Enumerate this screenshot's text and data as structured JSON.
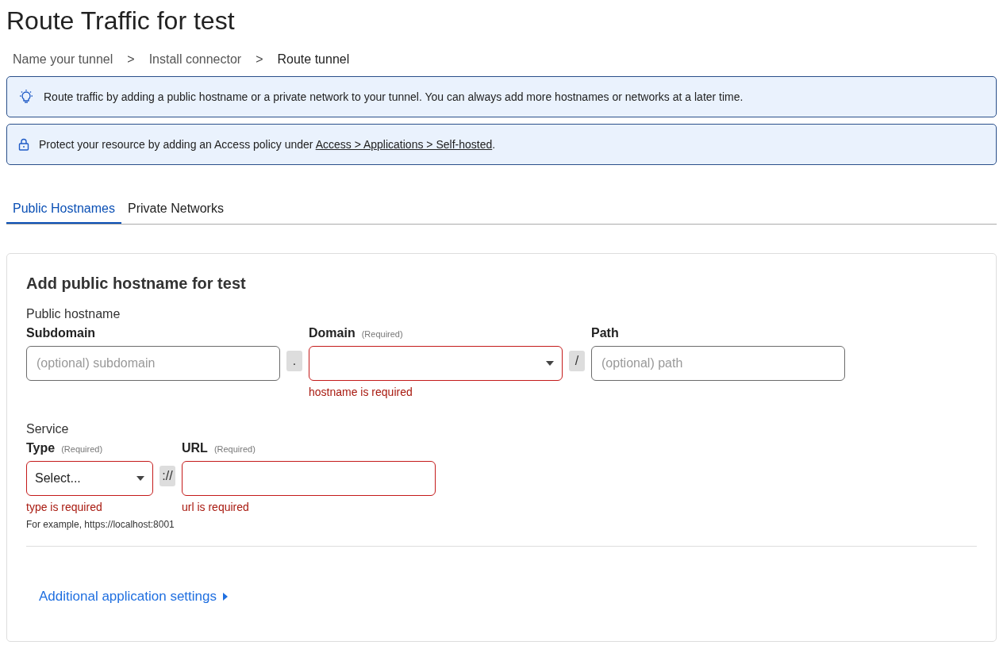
{
  "title": "Route Traffic for test",
  "breadcrumb": [
    {
      "label": "Name your tunnel",
      "current": false
    },
    {
      "label": ">",
      "kind": "sep"
    },
    {
      "label": "Install connector",
      "current": false
    },
    {
      "label": ">",
      "kind": "sep"
    },
    {
      "label": "Route tunnel",
      "current": true
    }
  ],
  "notices": [
    {
      "kind": "tip",
      "text": "Route traffic by adding a public hostname or a private network to your tunnel. You can always add more hostnames or networks at a later time."
    },
    {
      "kind": "lock",
      "text": "Protect your resource by adding an Access policy under ",
      "link": "Access > Applications > Self-hosted",
      "after": "."
    }
  ],
  "tabs": [
    {
      "label": "Public Hostnames",
      "selected": true
    },
    {
      "label": "Private Networks",
      "selected": false
    }
  ],
  "card": {
    "heading": "Add public hostname for test",
    "sections": [
      {
        "label": "Public hostname",
        "items": [
          {
            "kind": "text",
            "label": "Subdomain",
            "placeholder": "(optional) subdomain"
          },
          {
            "kind": "sep",
            "text": "."
          },
          {
            "kind": "select",
            "label": "Domain",
            "required": "(Required)",
            "error": "hostname is required"
          },
          {
            "kind": "sep",
            "text": "/"
          },
          {
            "kind": "text",
            "label": "Path",
            "placeholder": "(optional) path"
          }
        ]
      },
      {
        "label": "Service",
        "items": [
          {
            "kind": "select",
            "label": "Type",
            "required": "(Required)",
            "value": "Select...",
            "error": "type is required",
            "hint": "For example, https://localhost:8001"
          },
          {
            "kind": "sep",
            "text": "://"
          },
          {
            "kind": "text",
            "label": "URL",
            "required": "(Required)",
            "error": "url is required"
          }
        ]
      }
    ],
    "more_link": "Additional application settings"
  }
}
